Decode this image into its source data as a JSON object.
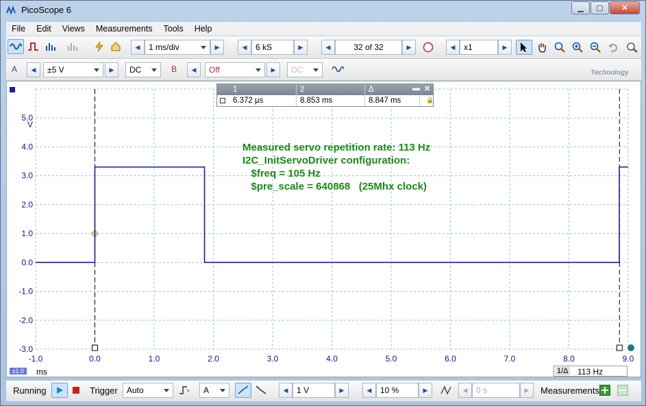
{
  "window": {
    "title": "PicoScope 6",
    "minimize_glyph": "▁",
    "maximize_glyph": "▢",
    "close_glyph": "✕"
  },
  "menu": [
    "File",
    "Edit",
    "Views",
    "Measurements",
    "Tools",
    "Help"
  ],
  "toolbar1": {
    "timebase": "1 ms/div",
    "samples": "6 kS",
    "buffer": "32 of 32",
    "zoom": "x1",
    "brand_text": "Technology"
  },
  "toolbar2": {
    "channel_a_label": "A",
    "channel_a_range": "±5 V",
    "channel_a_coupling": "DC",
    "channel_b_label": "B",
    "channel_b_range": "Off",
    "channel_b_coupling": "DC"
  },
  "rulers": {
    "headers": [
      "1",
      "2",
      "Δ"
    ],
    "values": [
      "6.372 µs",
      "8.853 ms",
      "8.847 ms"
    ]
  },
  "annotation": [
    "Measured servo repetition rate: 113 Hz",
    "I2C_InitServoDriver configuration:",
    "   $freq = 105 Hz",
    "   $pre_scale = 640868   (25Mhx clock)"
  ],
  "axis": {
    "y_unit": "V",
    "x_unit": "ms",
    "x_zoom_badge": "x1.0",
    "y_ticks": [
      "5.0",
      "4.0",
      "3.0",
      "2.0",
      "1.0",
      "0.0",
      "-1.0",
      "-2.0",
      "-3.0"
    ],
    "x_ticks": [
      "-1.0",
      "0.0",
      "1.0",
      "2.0",
      "3.0",
      "4.0",
      "5.0",
      "6.0",
      "7.0",
      "8.0",
      "9.0"
    ]
  },
  "frequency_readout": {
    "label": "1/Δ",
    "value": "113 Hz"
  },
  "statusbar": {
    "state": "Running",
    "trigger_label": "Trigger",
    "trigger_mode": "Auto",
    "trigger_channel": "A",
    "threshold": "1 V",
    "pre_trigger": "10 %",
    "delay": "0 s",
    "measurements_label": "Measurements"
  },
  "colors": {
    "trace": "#1a1aa6",
    "annotation": "#1a8a17",
    "grid": "#8cc8d8"
  },
  "chart_data": {
    "type": "line",
    "xlabel": "ms",
    "ylabel": "V",
    "xlim": [
      -1.0,
      9.0
    ],
    "ylim": [
      -3.0,
      6.0
    ],
    "series": [
      {
        "x": [
          -1.0,
          0.0,
          0.0,
          1.85,
          1.85,
          8.85,
          8.85,
          9.0
        ],
        "y": [
          0.0,
          0.0,
          3.3,
          3.3,
          0.0,
          0.0,
          3.3,
          3.3
        ]
      }
    ],
    "cursors_ms": [
      0.0,
      8.853
    ],
    "trigger_point": {
      "x": 0.0,
      "y": 1.0
    }
  }
}
